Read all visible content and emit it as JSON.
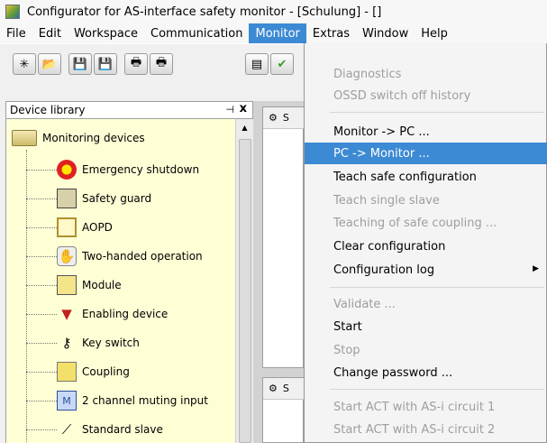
{
  "window": {
    "title": "Configurator for AS-interface safety monitor - [Schulung] - []"
  },
  "menubar": {
    "items": [
      "File",
      "Edit",
      "Workspace",
      "Communication",
      "Monitor",
      "Extras",
      "Window",
      "Help"
    ]
  },
  "library": {
    "title": "Device library",
    "pin": "\u0004",
    "close": "x",
    "root": "Monitoring devices",
    "items": [
      "Emergency shutdown",
      "Safety guard",
      "AOPD",
      "Two-handed operation",
      "Module",
      "Enabling device",
      "Key switch",
      "Coupling",
      "2 channel muting input",
      "Standard slave"
    ]
  },
  "panes": [
    {
      "tab": "S"
    },
    {
      "tab": "S"
    }
  ],
  "monitor_menu": {
    "items": [
      {
        "label": "Diagnostics",
        "enabled": false
      },
      {
        "label": "OSSD switch off history",
        "enabled": false
      },
      {
        "label": "Monitor -> PC ...",
        "enabled": true
      },
      {
        "label": "PC -> Monitor ...",
        "enabled": true,
        "selected": true
      },
      {
        "label": "Teach safe configuration",
        "enabled": true
      },
      {
        "label": "Teach single slave",
        "enabled": false
      },
      {
        "label": "Teaching of safe coupling ...",
        "enabled": false
      },
      {
        "label": "Clear configuration",
        "enabled": true
      },
      {
        "label": "Configuration log",
        "enabled": true,
        "submenu": true
      },
      {
        "label": "Validate ...",
        "enabled": false
      },
      {
        "label": "Start",
        "enabled": true
      },
      {
        "label": "Stop",
        "enabled": false
      },
      {
        "label": "Change password ...",
        "enabled": true
      },
      {
        "label": "Start ACT with AS-i circuit 1",
        "enabled": false
      },
      {
        "label": "Start ACT with AS-i circuit 2",
        "enabled": false
      }
    ]
  },
  "colors": {
    "menu_highlight": "#3c8ad3",
    "library_bg": "#ffffd6",
    "disabled_text": "#9e9e9e"
  }
}
